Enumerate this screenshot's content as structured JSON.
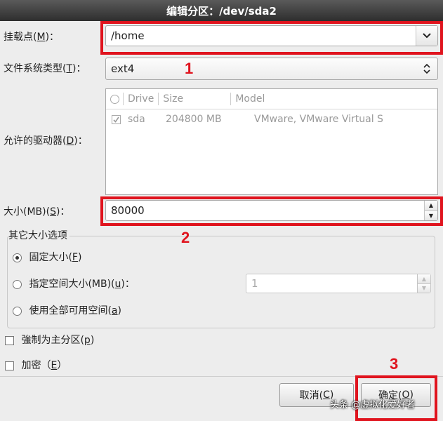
{
  "title": "编辑分区：/dev/sda2",
  "mount_point": {
    "label_pre": "挂载点(",
    "label_key": "M",
    "label_post": ")：",
    "value": "/home"
  },
  "fs_type": {
    "label_pre": "文件系统类型(",
    "label_key": "T",
    "label_post": ")：",
    "value": "ext4"
  },
  "drives": {
    "label_pre": "允许的驱动器(",
    "label_key": "D",
    "label_post": ")：",
    "columns": [
      "Drive",
      "Size",
      "Model"
    ],
    "rows": [
      {
        "drive": "sda",
        "size": "204800 MB",
        "model": "VMware, VMware Virtual S"
      }
    ]
  },
  "size": {
    "label_pre": "大小(MB)(",
    "label_key": "S",
    "label_post": ")：",
    "value": "80000"
  },
  "other_size": {
    "legend": "其它大小选项",
    "fixed": {
      "pre": "固定大小(",
      "key": "F",
      "post": ")"
    },
    "fill_to": {
      "pre": "指定空间大小(MB)(",
      "key": "u",
      "post": ")：",
      "value": "1"
    },
    "fill_all": {
      "pre": "使用全部可用空间(",
      "key": "a",
      "post": ")"
    }
  },
  "force_primary": {
    "pre": "強制为主分区(",
    "key": "p",
    "post": ")"
  },
  "encrypt": {
    "pre": "加密（",
    "key": "E",
    "post": "）"
  },
  "buttons": {
    "cancel": {
      "pre": "取消(",
      "key": "C",
      "post": ")"
    },
    "ok": {
      "pre": "确定(",
      "key": "O",
      "post": ")"
    }
  },
  "annotations": [
    "1",
    "2",
    "3"
  ],
  "watermark": "头条 @虚拟化爱好者",
  "colors": {
    "highlight": "#e0141e",
    "titlebar": "#3a3a3a"
  }
}
